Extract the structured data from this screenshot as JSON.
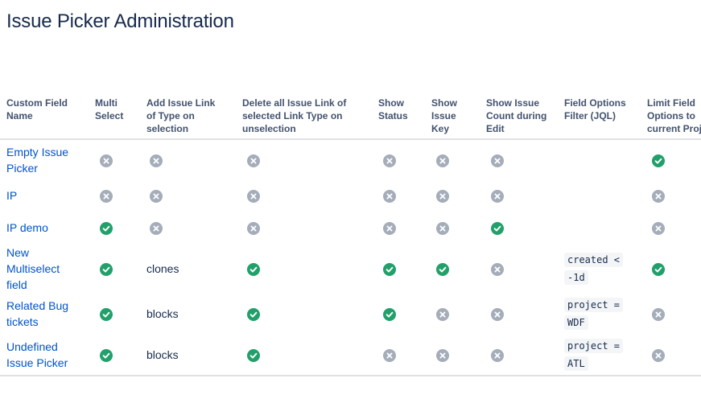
{
  "page": {
    "title": "Issue Picker Administration"
  },
  "table": {
    "headers": [
      "Custom Field Name",
      "Multi Select",
      "Add Issue Link of Type on selection",
      "Delete all Issue Link of selected Link Type on unselection",
      "Show Status",
      "Show Issue Key",
      "Show Issue Count during Edit",
      "Field Options Filter (JQL)",
      "Limit Field Options to current Project"
    ],
    "rows": [
      {
        "name": "Empty Issue Picker",
        "multi": "cross-icon",
        "add_link": "cross-icon",
        "add_link_text": "",
        "delete_link": "cross-icon",
        "status": "cross-icon",
        "key": "cross-icon",
        "count": "cross-icon",
        "jql": "",
        "limit": "check-icon"
      },
      {
        "name": "IP",
        "multi": "cross-icon",
        "add_link": "cross-icon",
        "add_link_text": "",
        "delete_link": "cross-icon",
        "status": "cross-icon",
        "key": "cross-icon",
        "count": "cross-icon",
        "jql": "",
        "limit": "cross-icon"
      },
      {
        "name": "IP demo",
        "multi": "check-icon",
        "add_link": "cross-icon",
        "add_link_text": "",
        "delete_link": "cross-icon",
        "status": "cross-icon",
        "key": "cross-icon",
        "count": "check-icon",
        "jql": "",
        "limit": "cross-icon"
      },
      {
        "name": "New Multiselect field",
        "multi": "check-icon",
        "add_link": "",
        "add_link_text": "clones",
        "delete_link": "check-icon",
        "status": "check-icon",
        "key": "check-icon",
        "count": "cross-icon",
        "jql": "created < -1d",
        "limit": "check-icon"
      },
      {
        "name": "Related Bug tickets",
        "multi": "check-icon",
        "add_link": "",
        "add_link_text": "blocks",
        "delete_link": "check-icon",
        "status": "check-icon",
        "key": "cross-icon",
        "count": "cross-icon",
        "jql": "project = WDF",
        "limit": "cross-icon"
      },
      {
        "name": "Undefined Issue Picker",
        "multi": "check-icon",
        "add_link": "",
        "add_link_text": "blocks",
        "delete_link": "check-icon",
        "status": "cross-icon",
        "key": "cross-icon",
        "count": "cross-icon",
        "jql": "project = ATL",
        "limit": "cross-icon"
      }
    ]
  },
  "colors": {
    "check": "#22a06b",
    "cross": "#a5adba",
    "link": "#0052cc",
    "header_text": "#42526e"
  }
}
